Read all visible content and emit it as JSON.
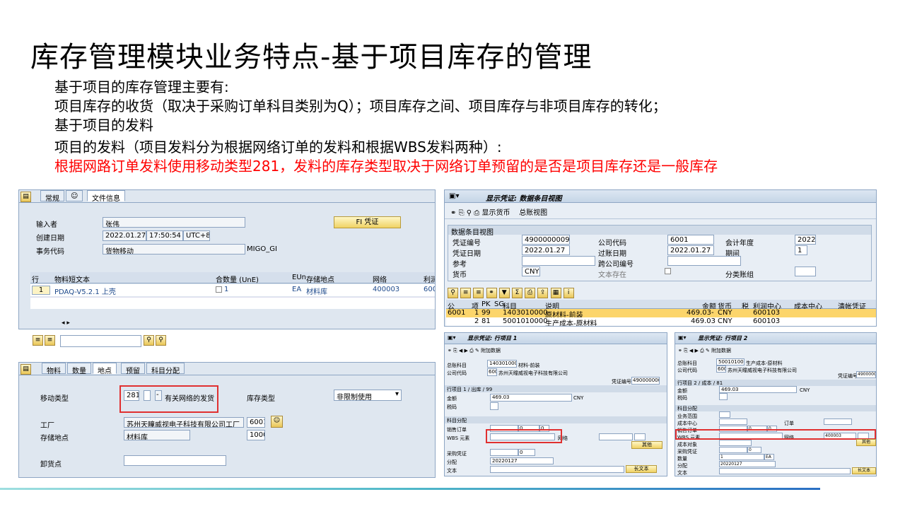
{
  "slide": {
    "title": "库存管理模块业务特点-基于项目库存的管理",
    "lines": [
      "基于项目的库存管理主要有:",
      "项目库存的收货（取决于采购订单科目类别为Q）；项目库存之间、项目库存与非项目库存的转化；",
      "基于项目的发料",
      "项目的发料（项目发料分为根据网络订单的发料和根据WBS发料两种）:"
    ],
    "red_line": "根据网路订单发料使用移动类型281，发料的库存类型取决于网络订单预留的是否是项目库存还是一般库存"
  },
  "migo": {
    "tabs": [
      "常规",
      "文件信息"
    ],
    "entered_by_label": "输入者",
    "entered_by": "张伟",
    "fi_button": "FI 凭证",
    "created_label": "创建日期",
    "created_date": "2022.01.27",
    "created_time": "17:50:54",
    "tz": "UTC+8",
    "tcode_label": "事务代码",
    "tcode_text": "货物移动",
    "tcode": "MIGO_GI",
    "cols": [
      "行",
      "物料短文本",
      "合",
      "数量 (UnE)",
      "EUn",
      "存储地点",
      "网络",
      "利润"
    ],
    "row": {
      "line": "1",
      "material": "PDAQ-V5.2.1 上壳",
      "qty": "1",
      "unit": "EA",
      "sloc": "材料库",
      "network": "400003",
      "profit": "600"
    }
  },
  "migo_detail": {
    "tabs": [
      "物料",
      "数量",
      "地点",
      "预留",
      "科目分配"
    ],
    "mvt_label": "移动类型",
    "mvt": "281",
    "mvt_dash": "-",
    "mvt_text": "有关网络的发货",
    "stock_type_label": "库存类型",
    "stock_type": "非限制使用",
    "plant_label": "工厂",
    "plant_name": "苏州天瞳威视电子科技有限公司工厂",
    "plant": "6001",
    "sloc_label": "存储地点",
    "sloc_name": "材料库",
    "sloc": "1000",
    "unload_label": "卸货点"
  },
  "doc": {
    "title": "显示凭证: 数据条目视图",
    "toolbar_currency": "显示货币",
    "toolbar_ledger": "总账视图",
    "section": "数据条目视图",
    "doc_no_label": "凭证编号",
    "doc_no": "4900000009",
    "company_label": "公司代码",
    "company": "6001",
    "fy_label": "会计年度",
    "fy": "2022",
    "doc_date_label": "凭证日期",
    "doc_date": "2022.01.27",
    "post_date_label": "过账日期",
    "post_date": "2022.01.27",
    "period_label": "期间",
    "period": "1",
    "ref_label": "参考",
    "cross_label": "跨公司编号",
    "cur_label": "货币",
    "cur": "CNY",
    "text_label": "文本存在",
    "ledger_label": "分类账组",
    "cols": [
      "公",
      "项",
      "PK",
      "SG",
      "科目",
      "说明",
      "金额",
      "货币",
      "税",
      "利润中心",
      "成本中心",
      "清帐凭证"
    ],
    "rows": [
      [
        "6001",
        "1",
        "99",
        "",
        "1403010000",
        "原材料-前装",
        "469.03-",
        "CNY",
        "",
        "600103",
        "",
        ""
      ],
      [
        "",
        "2",
        "81",
        "",
        "5001010000",
        "生产成本-原材料",
        "469.03",
        "CNY",
        "",
        "600103",
        "",
        ""
      ]
    ]
  },
  "item1": {
    "title": "显示凭证: 行项目 1",
    "toolbar": "附加数据",
    "gl_label": "总账科目",
    "gl": "1403010000",
    "gl_text": "材料-前装",
    "cc_label": "公司代码",
    "cc": "6001",
    "cc_text": "苏州天瞳威视电子科技有限公司",
    "docno_label": "凭证编号",
    "docno": "4900000009",
    "sec1": "行项目 1 / 出库 / 99",
    "amt_label": "金额",
    "amt": "469.03",
    "amt_cur": "CNY",
    "tax_label": "税码",
    "sec2": "科目分配",
    "so_label": "销售订单",
    "wbs_label": "WBS 元素",
    "net_label": "网络",
    "more": "其他",
    "po_label": "采购凭证",
    "assign_label": "分配",
    "assign": "20220127",
    "text_label": "文本",
    "longtext": "长文本",
    "zero": "0"
  },
  "item2": {
    "title": "显示凭证: 行项目 2",
    "toolbar": "附加数据",
    "gl_label": "总账科目",
    "gl": "5001010000",
    "gl_text": "生产成本-原材料",
    "cc_label": "公司代码",
    "cc": "6001",
    "cc_text": "苏州天瞳威视电子科技有限公司",
    "docno_label": "凭证编号",
    "docno": "4900000009",
    "sec1": "行项目 2 / 成本 / 81",
    "amt_label": "金额",
    "amt": "469.03",
    "amt_cur": "CNY",
    "tax_label": "税码",
    "sec2": "科目分配",
    "bus_label": "业务范围",
    "costc_label": "成本中心",
    "order_label": "订单",
    "so_label": "销售订单",
    "wbs_label": "WBS 元素",
    "net_label": "网络",
    "net": "400003",
    "costobj_label": "成本对象",
    "more": "其他",
    "po_label": "采购凭证",
    "qty_label": "数量",
    "qty": "1",
    "qty_unit": "EA",
    "assign_label": "分配",
    "assign": "20220127",
    "text_label": "文本",
    "longtext": "长文本",
    "zero": "0"
  }
}
